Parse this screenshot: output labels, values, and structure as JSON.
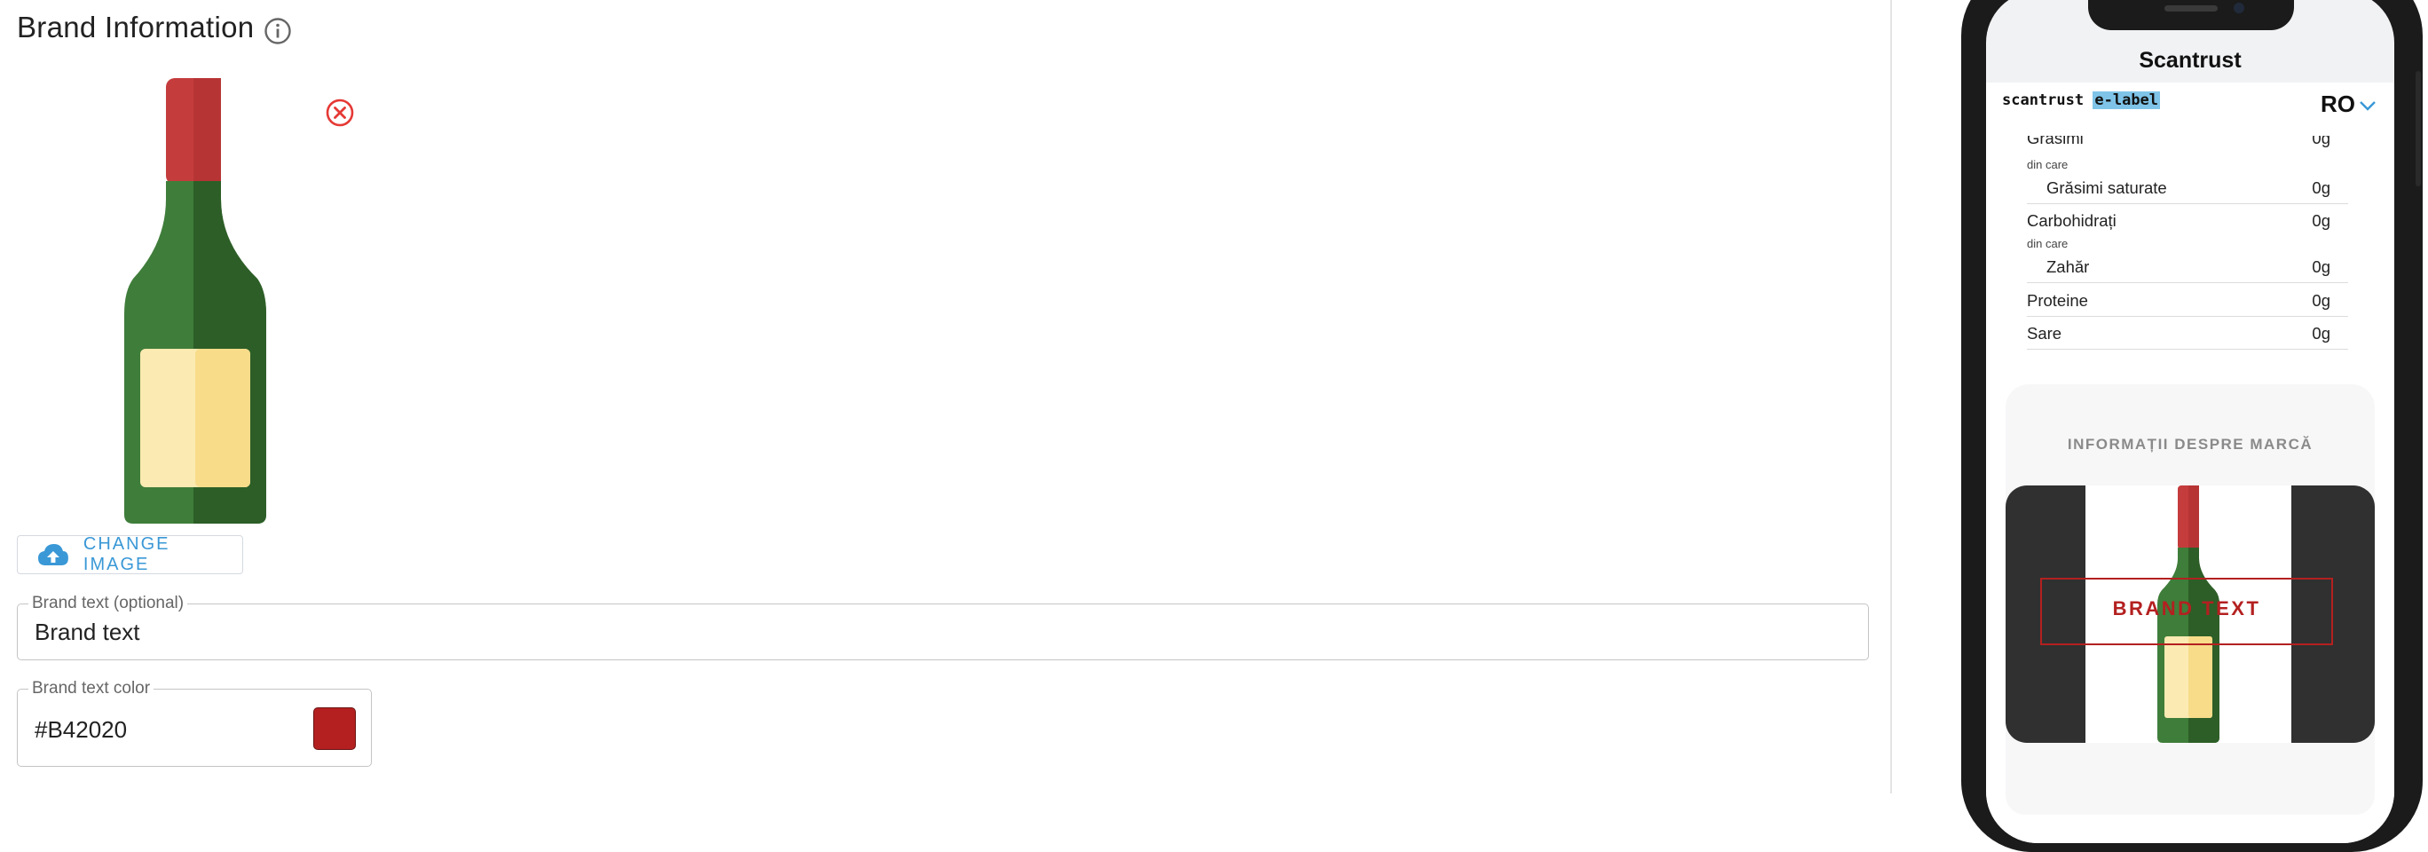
{
  "section": {
    "title": "Brand Information",
    "change_image_label": "CHANGE IMAGE",
    "brand_text_field": {
      "legend": "Brand text (optional)",
      "value": "Brand text"
    },
    "brand_color_field": {
      "legend": "Brand text color",
      "value": "#B42020"
    }
  },
  "colors": {
    "brand_text": "#B42020",
    "accent": "#3A98D6",
    "remove": "#E53935"
  },
  "preview": {
    "app_title": "Scantrust",
    "logo_text": "scantrust",
    "logo_badge": "e-label",
    "language": "RO",
    "nutrition": [
      {
        "name": "Grăsimi",
        "value": "0g"
      },
      {
        "note": "din care"
      },
      {
        "name": "Grăsimi saturate",
        "value": "0g"
      },
      {
        "name": "Carbohidrați",
        "value": "0g"
      },
      {
        "note": "din care"
      },
      {
        "name": "Zahăr",
        "value": "0g"
      },
      {
        "name": "Proteine",
        "value": "0g"
      },
      {
        "name": "Sare",
        "value": "0g"
      }
    ],
    "brand_heading": "INFORMAȚII DESPRE MARCĂ",
    "brand_banner_text": "BRAND TEXT"
  },
  "icons": [
    "info-icon",
    "remove-icon",
    "cloud-upload-icon",
    "chevron-down-icon",
    "bottle-image"
  ]
}
